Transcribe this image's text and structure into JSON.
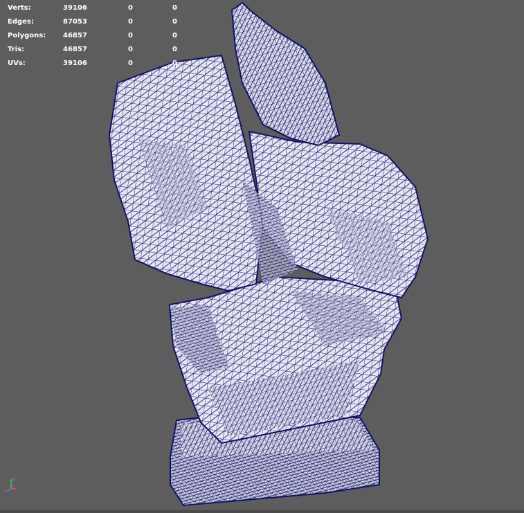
{
  "hud": {
    "rows": [
      {
        "label": "Verts:",
        "v1": "39106",
        "v2": "0",
        "v3": "0"
      },
      {
        "label": "Edges:",
        "v1": "87053",
        "v2": "0",
        "v3": "0"
      },
      {
        "label": "Polygons:",
        "v1": "46857",
        "v2": "0",
        "v3": "0"
      },
      {
        "label": "Tris:",
        "v1": "46857",
        "v2": "0",
        "v3": "0"
      },
      {
        "label": "UVs:",
        "v1": "39106",
        "v2": "0",
        "v3": "0"
      }
    ]
  },
  "viewport": {
    "background_color": "#5d5d5d",
    "mesh_fill_color": "#e8e8f0",
    "wire_color": "#1a1a78"
  },
  "axis": {
    "y_label": "y",
    "z_label": "z",
    "x_label": "x",
    "y_color": "#4cc84c",
    "z_color": "#4f7cff",
    "x_color": "#e05050"
  }
}
